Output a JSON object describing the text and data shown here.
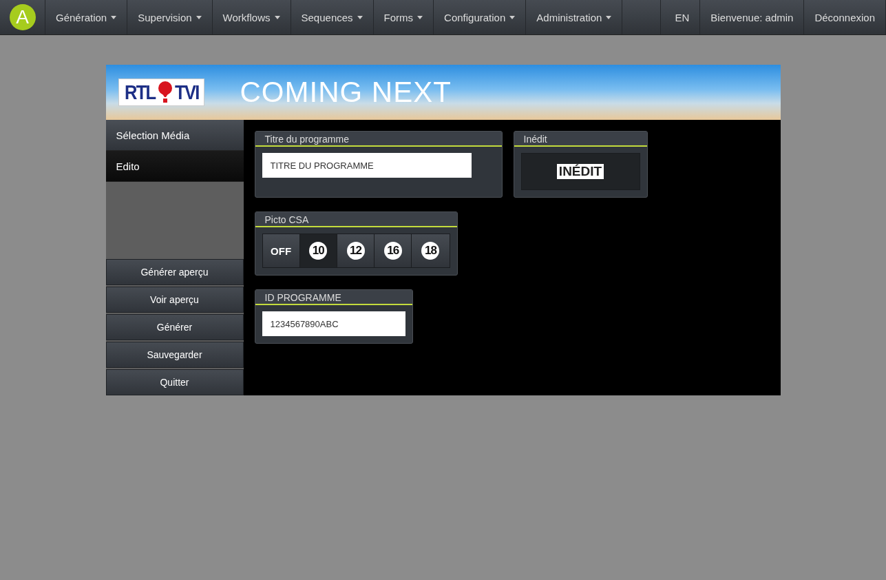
{
  "navbar": {
    "logo": "A",
    "menus": [
      {
        "label": "Génération",
        "dropdown": true
      },
      {
        "label": "Supervision",
        "dropdown": true
      },
      {
        "label": "Workflows",
        "dropdown": true
      },
      {
        "label": "Sequences",
        "dropdown": true
      },
      {
        "label": "Forms",
        "dropdown": true
      },
      {
        "label": "Configuration",
        "dropdown": true
      },
      {
        "label": "Administration",
        "dropdown": true
      }
    ],
    "right": [
      "EN",
      "Bienvenue: admin",
      "Déconnexion"
    ]
  },
  "banner": {
    "logo_left": "RTL",
    "logo_right": "TVI",
    "title": "COMING NEXT"
  },
  "sidebar": {
    "items": [
      {
        "label": "Sélection Média",
        "selected": false
      },
      {
        "label": "Edito",
        "selected": true
      }
    ],
    "actions": [
      "Générer aperçu",
      "Voir aperçu",
      "Générer",
      "Sauvegarder",
      "Quitter"
    ]
  },
  "panels": {
    "title_panel": {
      "heading": "Titre du programme",
      "value": "TITRE DU PROGRAMME"
    },
    "inedit_panel": {
      "heading": "Inédit",
      "label": "INÉDIT",
      "on": true
    },
    "csa_panel": {
      "heading": "Picto CSA",
      "options": [
        {
          "kind": "text",
          "label": "OFF",
          "selected": false
        },
        {
          "kind": "badge",
          "label": "10",
          "selected": true
        },
        {
          "kind": "badge",
          "label": "12",
          "selected": false
        },
        {
          "kind": "badge",
          "label": "16",
          "selected": false
        },
        {
          "kind": "badge",
          "label": "18",
          "selected": false
        }
      ]
    },
    "id_panel": {
      "heading": "ID PROGRAMME",
      "value": "1234567890ABC"
    }
  }
}
